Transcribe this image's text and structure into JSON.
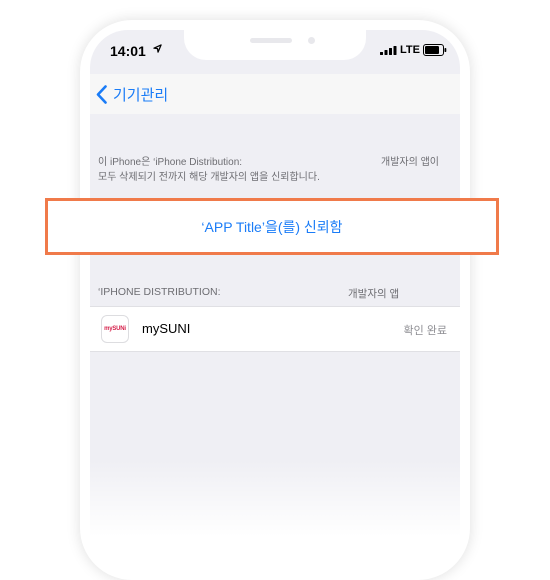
{
  "status_bar": {
    "time": "14:01",
    "network": "LTE"
  },
  "navbar": {
    "back_label": "기기관리"
  },
  "info": {
    "line1_left": "이 iPhone은 ‘iPhone Distribution:",
    "line1_right": "개발자의 앱이",
    "line2": "모두 삭제되기 전까지 해당 개발자의 앱을 신뢰합니다."
  },
  "trust": {
    "label": "‘APP Title’을(를) 신뢰함"
  },
  "section": {
    "header_left": "‘IPHONE DISTRIBUTION:",
    "header_right": "개발자의 앱"
  },
  "apps": [
    {
      "name": "mySUNI",
      "status": "확인 완료",
      "icon_text": "mySUNi"
    }
  ],
  "colors": {
    "accent": "#1a7cf7",
    "highlight": "#f07a4a",
    "app_logo": "#d5204a"
  }
}
